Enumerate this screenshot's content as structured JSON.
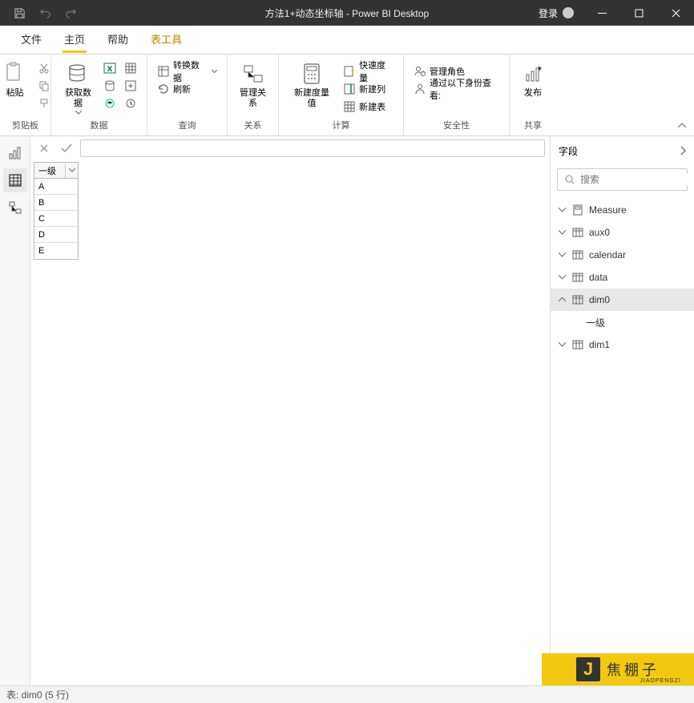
{
  "titlebar": {
    "title": "方法1+动态坐标轴 - Power BI Desktop",
    "login": "登录"
  },
  "tabs": {
    "file": "文件",
    "home": "主页",
    "help": "帮助",
    "tabletools": "表工具"
  },
  "ribbon": {
    "clipboard": {
      "paste": "粘贴",
      "label": "剪贴板"
    },
    "data": {
      "getdata": "获取数据",
      "label": "数据"
    },
    "query": {
      "transform": "转换数据",
      "refresh": "刷新",
      "label": "查询"
    },
    "relation": {
      "manage": "管理关系",
      "label": "关系"
    },
    "calc": {
      "measure": "新建度量值",
      "quick": "快速度量",
      "column": "新建列",
      "table": "新建表",
      "label": "计算"
    },
    "security": {
      "roles": "管理角色",
      "viewas": "通过以下身份查看:",
      "label": "安全性"
    },
    "share": {
      "publish": "发布",
      "label": "共享"
    }
  },
  "grid": {
    "header": "一级",
    "rows": [
      "A",
      "B",
      "C",
      "D",
      "E"
    ]
  },
  "fields": {
    "title": "字段",
    "search_placeholder": "搜索",
    "items": [
      {
        "name": "Measure",
        "type": "measure",
        "expanded": false
      },
      {
        "name": "aux0",
        "type": "table",
        "expanded": false
      },
      {
        "name": "calendar",
        "type": "table",
        "expanded": false
      },
      {
        "name": "data",
        "type": "table",
        "expanded": false
      },
      {
        "name": "dim0",
        "type": "table",
        "expanded": true,
        "selected": true
      },
      {
        "name": "一级",
        "type": "column",
        "child": true
      },
      {
        "name": "dim1",
        "type": "table",
        "expanded": false
      }
    ]
  },
  "status": {
    "text": "表: dim0 (5 行)"
  },
  "watermark": {
    "logo": "J",
    "text": "焦棚子",
    "sub": "JIAOPENGZI"
  }
}
